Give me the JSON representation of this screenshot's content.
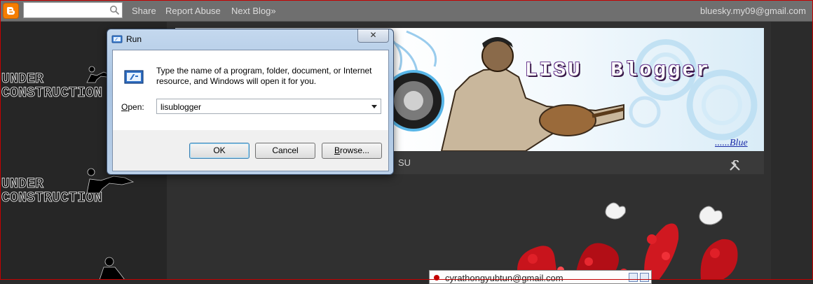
{
  "navbar": {
    "share": "Share",
    "report_abuse": "Report Abuse",
    "next_blog": "Next Blog»",
    "user_email": "bluesky.my09@gmail.com",
    "search_value": ""
  },
  "left_column": {
    "banners": [
      {
        "line1": "UNDER",
        "line2": "CONSTRUCTION"
      },
      {
        "line1": "UNDER",
        "line2": "CONSTRUCTION"
      }
    ]
  },
  "blog_header": {
    "title": "LISU  Blogger",
    "signature": "......Blue",
    "tab_fragment": "SU"
  },
  "chat_popup": {
    "email": "cyrathongyubtun@gmail.com"
  },
  "run_dialog": {
    "title": "Run",
    "close_glyph": "✕",
    "description": "Type the name of a program, folder, document, or Internet resource, and Windows will open it for you.",
    "open_label_prefix": "O",
    "open_label_rest": "pen:",
    "open_value": "lisublogger",
    "ok_label": "OK",
    "cancel_label": "Cancel",
    "browse_label_prefix": "B",
    "browse_label_rest": "rowse..."
  },
  "colors": {
    "navbar_bg": "#6f6f6f",
    "page_bg": "#2b2b2b",
    "blogger_orange": "#f57d00",
    "frame_red": "#c40000",
    "title_purple": "#6b3b8f"
  }
}
